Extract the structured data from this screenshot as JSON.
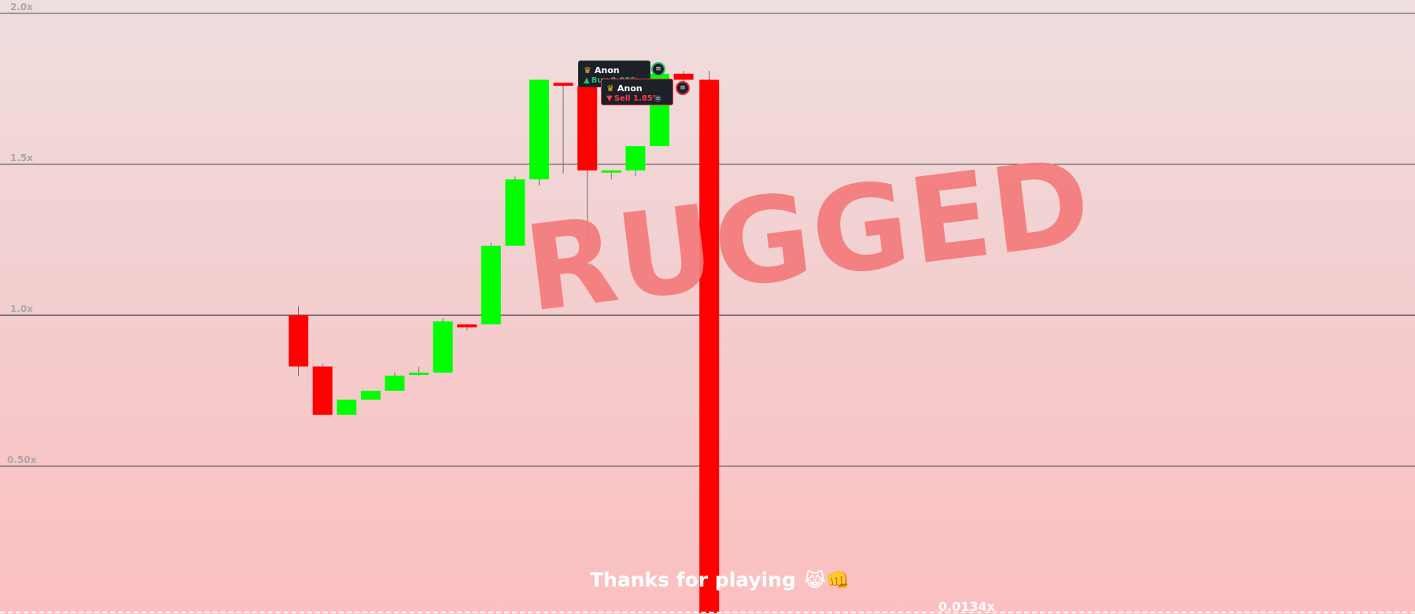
{
  "chart_data": {
    "type": "candlestick",
    "y_axis": {
      "ticks": [
        "2.0x",
        "1.5x",
        "1.0x",
        "0.50x"
      ],
      "tick_values": [
        2.0,
        1.5,
        1.0,
        0.5
      ],
      "ylim": [
        0.0134,
        2.0
      ],
      "grid": true
    },
    "candles": [
      {
        "open": 1.0,
        "close": 0.83,
        "high": 1.03,
        "low": 0.8
      },
      {
        "open": 0.83,
        "close": 0.67,
        "high": 0.84,
        "low": 0.67
      },
      {
        "open": 0.67,
        "close": 0.72,
        "high": 0.72,
        "low": 0.67
      },
      {
        "open": 0.72,
        "close": 0.75,
        "high": 0.75,
        "low": 0.72
      },
      {
        "open": 0.75,
        "close": 0.8,
        "high": 0.81,
        "low": 0.75
      },
      {
        "open": 0.805,
        "close": 0.81,
        "high": 0.83,
        "low": 0.8
      },
      {
        "open": 0.81,
        "close": 0.98,
        "high": 0.99,
        "low": 0.81
      },
      {
        "open": 0.97,
        "close": 0.96,
        "high": 0.97,
        "low": 0.95
      },
      {
        "open": 0.97,
        "close": 1.23,
        "high": 1.24,
        "low": 0.97
      },
      {
        "open": 1.23,
        "close": 1.45,
        "high": 1.46,
        "low": 1.23
      },
      {
        "open": 1.45,
        "close": 1.78,
        "high": 1.78,
        "low": 1.43
      },
      {
        "open": 1.77,
        "close": 1.76,
        "high": 1.77,
        "low": 1.47
      },
      {
        "open": 1.76,
        "close": 1.48,
        "high": 1.77,
        "low": 1.25
      },
      {
        "open": 1.48,
        "close": 1.48,
        "high": 1.48,
        "low": 1.45
      },
      {
        "open": 1.48,
        "close": 1.56,
        "high": 1.56,
        "low": 1.46
      },
      {
        "open": 1.56,
        "close": 1.8,
        "high": 1.82,
        "low": 1.56
      },
      {
        "open": 1.8,
        "close": 1.78,
        "high": 1.81,
        "low": 1.77
      },
      {
        "open": 1.78,
        "close": 0.0134,
        "high": 1.81,
        "low": 0.0134
      }
    ],
    "colors": {
      "up": "#00ff00",
      "down": "#ff0000",
      "wick": "#707070",
      "grid": "#4a4a4a"
    }
  },
  "overlay": {
    "status_text": "RUGGED",
    "status_color": "#f47b7b",
    "footer_message": "Thanks for playing",
    "footer_emoji": "😹👊",
    "current_multiplier": "0.0134x"
  },
  "trades": [
    {
      "user": "Anon",
      "icon": "crown-icon",
      "action_symbol": "▲",
      "action": "Buy 0.001",
      "token_icon": "token-icon",
      "type": "buy",
      "color": "#2fbf6a"
    },
    {
      "user": "Anon",
      "icon": "crown-icon",
      "action_symbol": "▼",
      "action": "Sell 1.85%",
      "token_icon": "token-icon",
      "type": "sell",
      "color": "#ff3b4e"
    }
  ]
}
